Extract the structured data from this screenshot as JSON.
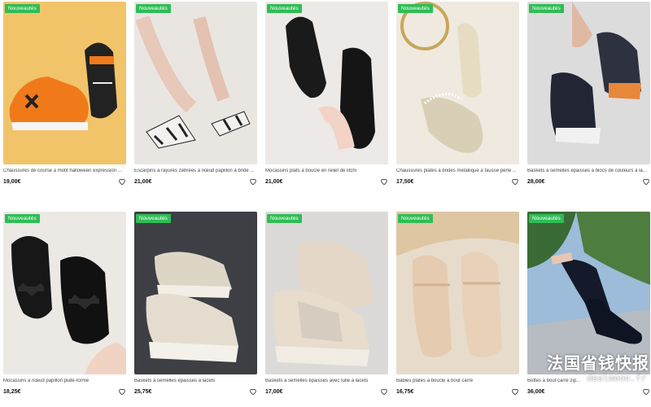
{
  "products": [
    {
      "badge": "Nouveautés",
      "title": "Chaussures de course à motif halloween expression à ...",
      "price": "19,00€",
      "bg": "#f1c46a"
    },
    {
      "badge": "Nouveautés",
      "title": "Escarpins à rayures zébrées à nœud papillon à bride ...",
      "price": "21,00€",
      "bg": "#e9e6e2"
    },
    {
      "badge": "Nouveautés",
      "title": "Mocassins plats à boucle en relief de litchi",
      "price": "21,00€",
      "bg": "#ece9e6"
    },
    {
      "badge": "Nouveautés",
      "title": "Chaussures plates à brides métallique à fausse perle ...",
      "price": "17,50€",
      "bg": "#efe9e0"
    },
    {
      "badge": "Nouveautés",
      "title": "Baskets à semelles épaisses à blocs de couleurs à lac...",
      "price": "28,00€",
      "bg": "#dcdcdc"
    },
    {
      "badge": "Nouveautés",
      "title": "Mocassins à nœud papillon plate-forme",
      "price": "18,25€",
      "bg": "#ece8e4"
    },
    {
      "badge": "Nouveautés",
      "title": "Baskets à semelles épaisses à lacets",
      "price": "25,75€",
      "bg": "#3d3f44"
    },
    {
      "badge": "Nouveautés",
      "title": "Baskets à semelles épaisses avec tulle à lacets",
      "price": "17,00€",
      "bg": "#dcdad8"
    },
    {
      "badge": "Nouveautés",
      "title": "Babies plates à boucle à bout carré",
      "price": "16,75€",
      "bg": "#e7dccb"
    },
    {
      "badge": "Nouveautés",
      "title": "Bottes à bout carré zip...",
      "price": "36,00€",
      "bg": "#9cbcd9"
    }
  ],
  "watermark": {
    "cn": "法国省钱快报",
    "site": "dealmoon.fr"
  }
}
